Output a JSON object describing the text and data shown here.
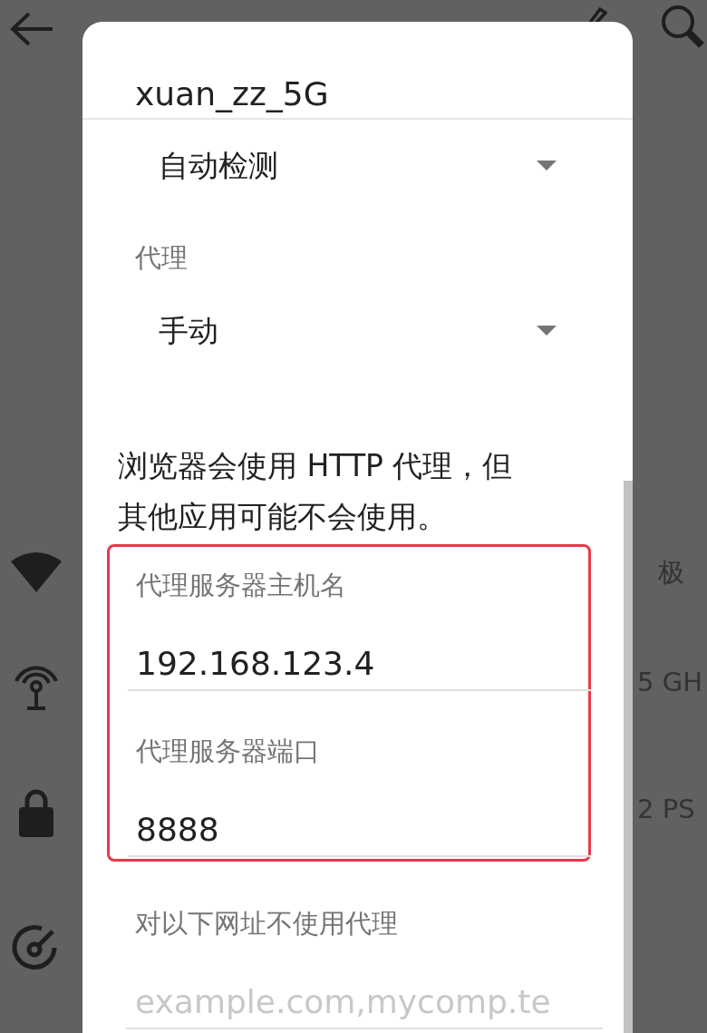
{
  "background": {
    "details": [
      {
        "kind": "signal",
        "value": "极"
      },
      {
        "kind": "frequency",
        "value": "5 GH"
      },
      {
        "kind": "security",
        "value": "2 PS"
      },
      {
        "kind": "speed"
      }
    ]
  },
  "dialog": {
    "title": "xuan_zz_5G",
    "fields": [
      {
        "kind": "dropdown",
        "value": "自动检测"
      },
      {
        "kind": "label",
        "text": "代理"
      },
      {
        "kind": "dropdown",
        "value": "手动"
      },
      {
        "kind": "note",
        "text": "浏览器会使用 HTTP 代理，但其他应用可能不会使用。"
      },
      {
        "kind": "group",
        "children": [
          {
            "kind": "label",
            "text": "代理服务器主机名"
          },
          {
            "kind": "input",
            "value": "192.168.123.4"
          },
          {
            "kind": "label",
            "text": "代理服务器端口"
          },
          {
            "kind": "input",
            "value": "8888"
          }
        ]
      },
      {
        "kind": "label",
        "text": "对以下网址不使用代理"
      },
      {
        "kind": "input",
        "placeholder": "example.com,mycomp.te"
      }
    ]
  }
}
